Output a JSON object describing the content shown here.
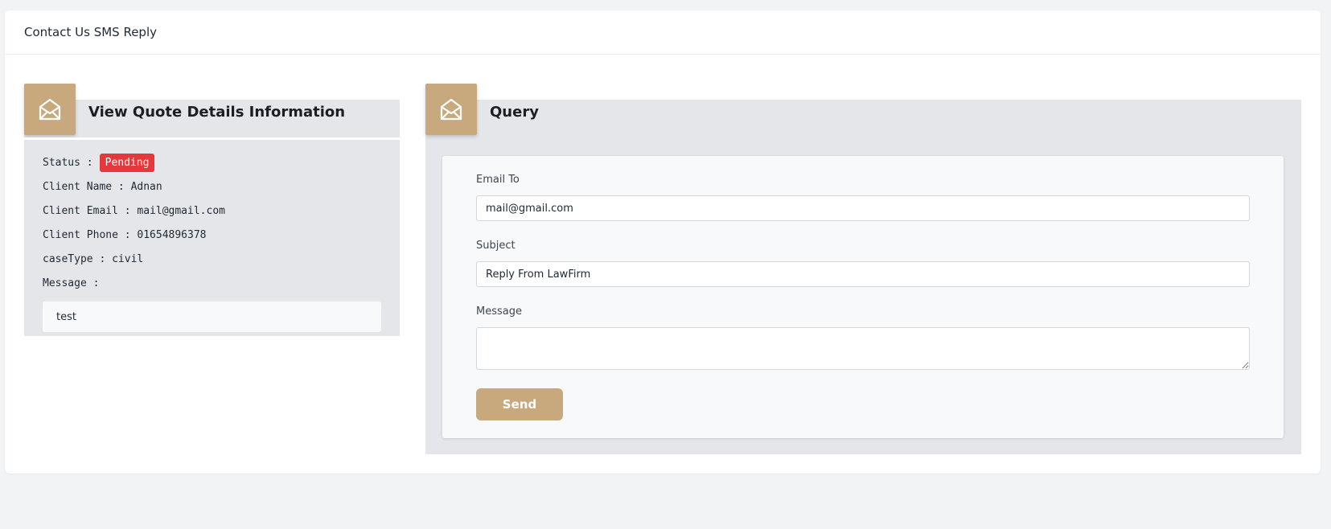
{
  "page": {
    "title": "Contact Us SMS Reply"
  },
  "quote_panel": {
    "title": "View Quote Details Information",
    "icon": "envelope-open-icon",
    "status_label": "Status :",
    "status_value": "Pending",
    "client_name": "Client Name : Adnan",
    "client_email": "Client Email : mail@gmail.com",
    "client_phone": "Client Phone : 01654896378",
    "case_type": "caseType : civil",
    "message_label": "Message :",
    "message_value": "test"
  },
  "query_panel": {
    "title": "Query",
    "icon": "envelope-open-icon",
    "email_label": "Email To",
    "email_value": "mail@gmail.com",
    "subject_label": "Subject",
    "subject_value": "Reply From LawFirm",
    "message_label": "Message",
    "message_value": "",
    "send_label": "Send"
  },
  "colors": {
    "accent": "#c8a97e",
    "status_pending": "#e5383b",
    "panel_bg": "#e5e6ea"
  }
}
